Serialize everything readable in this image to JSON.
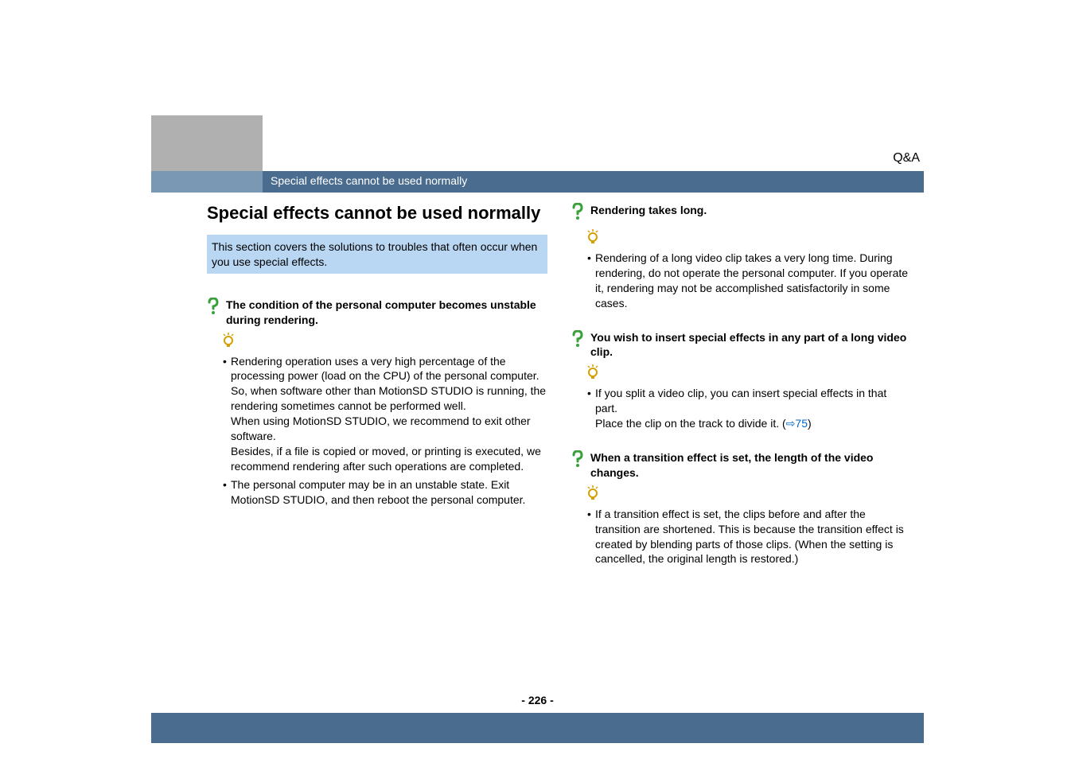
{
  "header": {
    "category": "Q&A",
    "breadcrumb": "Special effects cannot be used normally"
  },
  "main": {
    "title": "Special effects cannot be used normally",
    "intro": "This section covers the solutions to troubles that often occur when you use special effects."
  },
  "qa_left": [
    {
      "question": "The condition of the personal computer becomes unstable during rendering.",
      "answers": [
        "Rendering operation uses a very high percentage of the processing power (load on the CPU) of the personal computer. So, when software other than MotionSD STUDIO is running, the rendering sometimes cannot be performed well.\nWhen using MotionSD STUDIO, we recommend to exit other software.\nBesides, if a file is copied or moved, or printing is executed, we recommend rendering after such operations are completed.",
        "The personal computer may be in an unstable state. Exit MotionSD STUDIO, and then reboot the personal computer."
      ]
    }
  ],
  "qa_right": [
    {
      "question": "Rendering takes long.",
      "answers": [
        "Rendering of a long video clip takes a very long time. During rendering, do not operate the personal computer. If you operate it, rendering may not be accomplished satisfactorily in some cases."
      ]
    },
    {
      "question": "You wish to insert special effects in any part of a long video clip.",
      "answers_prefix": "If you split a video clip, you can insert special effects in that part.\nPlace the clip on the track to divide it. (",
      "link_label": "75",
      "answers_suffix": ")"
    },
    {
      "question": "When a transition effect is set, the length of the video changes.",
      "answers": [
        "If a transition effect is set, the clips before and after the transition are shortened. This is because the transition effect is created by blending parts of those clips. (When the setting is cancelled, the original length is restored.)"
      ]
    }
  ],
  "footer": {
    "page": "- 226 -"
  }
}
